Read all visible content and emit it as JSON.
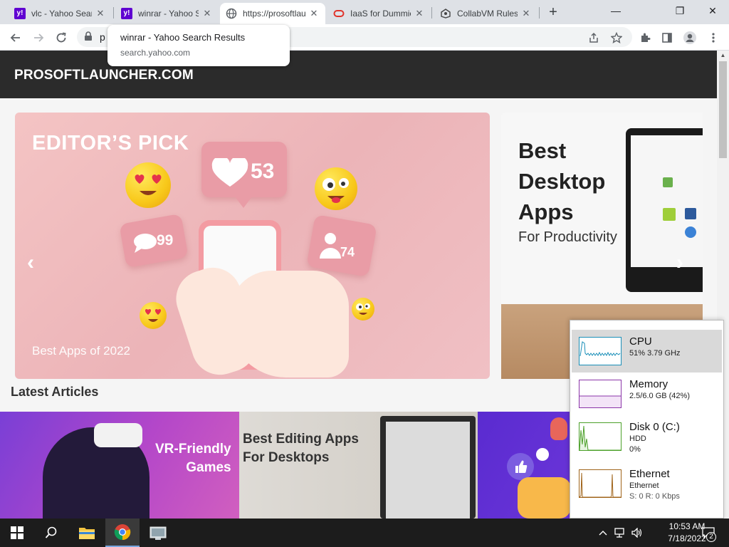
{
  "browser": {
    "tabs": [
      {
        "title": "vlc - Yahoo Search Results",
        "favicon": "yahoo-icon"
      },
      {
        "title": "winrar - Yahoo Search Results",
        "favicon": "yahoo-icon"
      },
      {
        "title": "https://prosoftlauncher.com",
        "favicon": "globe-icon",
        "active": true
      },
      {
        "title": "IaaS for Dummies",
        "favicon": "oracle-icon"
      },
      {
        "title": "CollabVM Rules",
        "favicon": "collabvm-icon"
      }
    ],
    "new_tab_label": "+",
    "window_controls": {
      "minimize": "—",
      "maximize": "❐",
      "close": "✕"
    },
    "address_prefix": "p",
    "tooltip": {
      "title": "winrar - Yahoo Search Results",
      "url": "search.yahoo.com"
    },
    "colors": {
      "tabstrip": "#dee1e6",
      "yahoo": "#5f01d1"
    }
  },
  "site": {
    "logo": "PROSOFTLAUNCHER.COM",
    "slide1": {
      "title": "EDITOR’S PICK",
      "subtitle": "Best Apps of 2022",
      "likes": "53",
      "comments": "99",
      "followers": "74"
    },
    "slide2": {
      "title_lines": [
        "Best",
        "Desktop",
        "Apps"
      ],
      "subtitle": "For Productivity"
    },
    "latest_heading": "Latest Articles",
    "articles": [
      {
        "title_lines": [
          "VR-Friendly",
          "Games"
        ]
      },
      {
        "title_lines": [
          "Best Editing Apps",
          "For Desktops"
        ]
      },
      {
        "title_lines": []
      }
    ],
    "prev_arrow": "‹",
    "next_arrow": "›"
  },
  "perf_flyout": {
    "items": [
      {
        "name": "CPU",
        "line2": "51% 3.79 GHz",
        "line3": "",
        "color": "#1a8fb8",
        "selected": true
      },
      {
        "name": "Memory",
        "line2": "2.5/6.0 GB (42%)",
        "line3": "",
        "color": "#8b35a8"
      },
      {
        "name": "Disk 0 (C:)",
        "line2": "HDD",
        "line3": "0%",
        "color": "#4ca02a"
      },
      {
        "name": "Ethernet",
        "line2": "Ethernet",
        "line3": "S: 0 R: 0 Kbps",
        "color": "#a0641a"
      }
    ]
  },
  "taskbar": {
    "clock_time": "10:53 AM",
    "clock_date": "7/18/2022",
    "notification_count": "2"
  }
}
